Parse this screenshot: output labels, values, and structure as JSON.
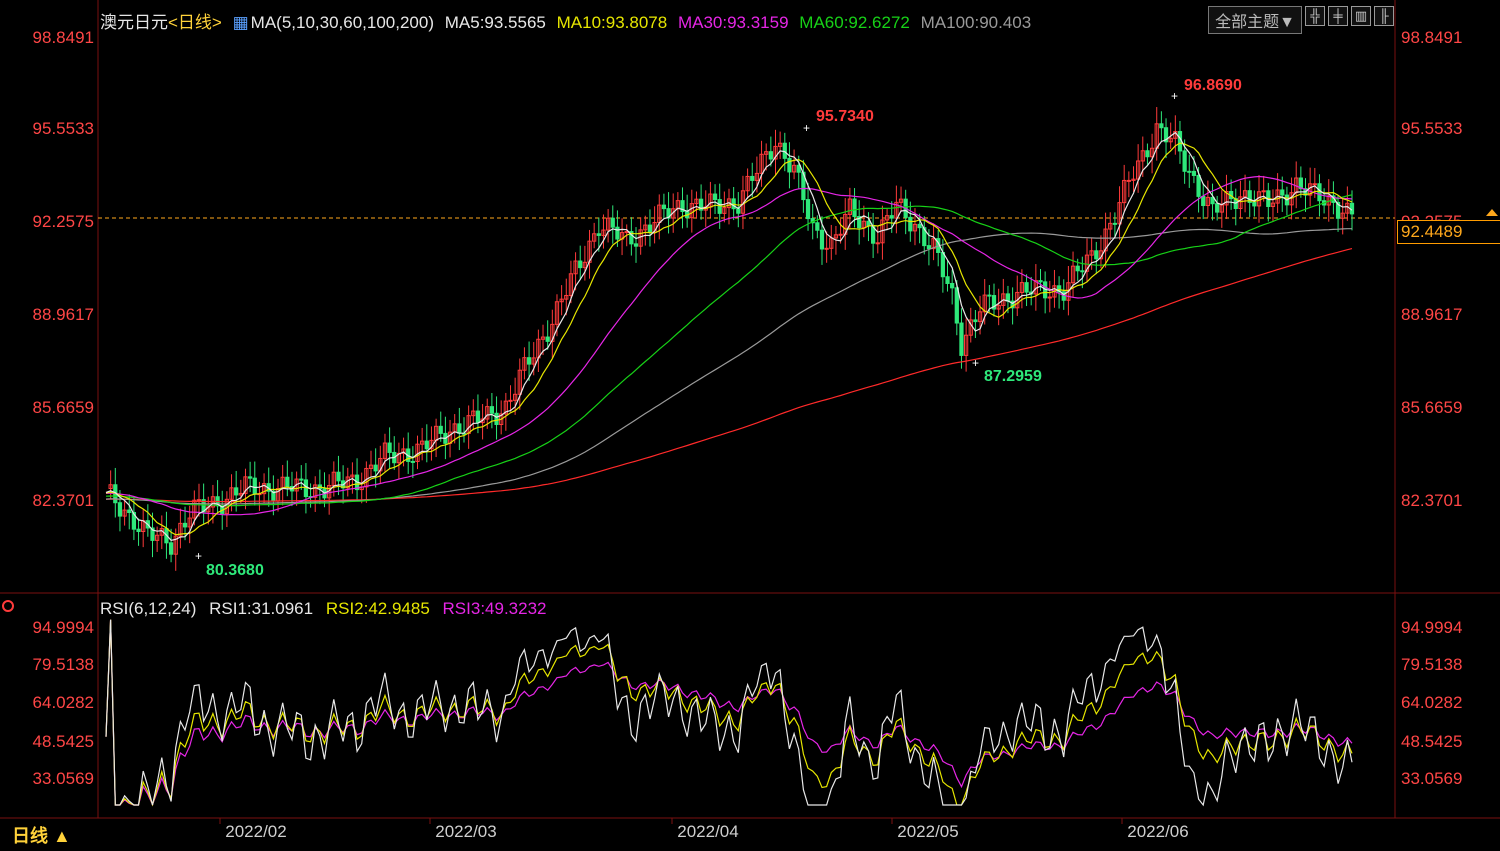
{
  "header": {
    "symbol": "澳元日元",
    "period_link": "<日线>",
    "ma_label": "MA(5,10,30,60,100,200)",
    "ma5": "MA5:93.5565",
    "ma10": "MA10:93.8078",
    "ma30": "MA30:93.3159",
    "ma60": "MA60:92.6272",
    "ma100": "MA100:90.403"
  },
  "toolbar": {
    "theme": "全部主题▼",
    "icons": [
      "grid-icon",
      "split-icon",
      "layout-icon",
      "panel-icon"
    ]
  },
  "current_price": "92.4489",
  "period_tag": "日线 ▲",
  "rsi_header": {
    "label": "RSI(6,12,24)",
    "rsi1": "RSI1:31.0961",
    "rsi2": "RSI2:42.9485",
    "rsi3": "RSI3:49.3232"
  },
  "colors": {
    "up": "#ff3b3b",
    "down": "#2ee87a",
    "ma5": "#e8e8e8",
    "ma10": "#e6e600",
    "ma30": "#e626e6",
    "ma60": "#17d117",
    "ma100": "#9a9a9a",
    "ma200": "#ff2a2a",
    "axis_text": "#ff4646",
    "grid": "#7a1010"
  },
  "chart_data": {
    "type": "candlestick",
    "x_labels": [
      "2022/02",
      "2022/03",
      "2022/04",
      "2022/05",
      "2022/06"
    ],
    "y_ticks": [
      "98.8491",
      "95.5533",
      "92.2575",
      "88.9617",
      "85.6659",
      "82.3701"
    ],
    "annotations": [
      {
        "text": "95.7340",
        "kind": "high"
      },
      {
        "text": "96.8690",
        "kind": "high"
      },
      {
        "text": "87.2959",
        "kind": "low"
      },
      {
        "text": "80.3680",
        "kind": "low"
      }
    ],
    "rsi_y_ticks": [
      "94.9994",
      "79.5138",
      "64.0282",
      "48.5425",
      "33.0569"
    ]
  }
}
